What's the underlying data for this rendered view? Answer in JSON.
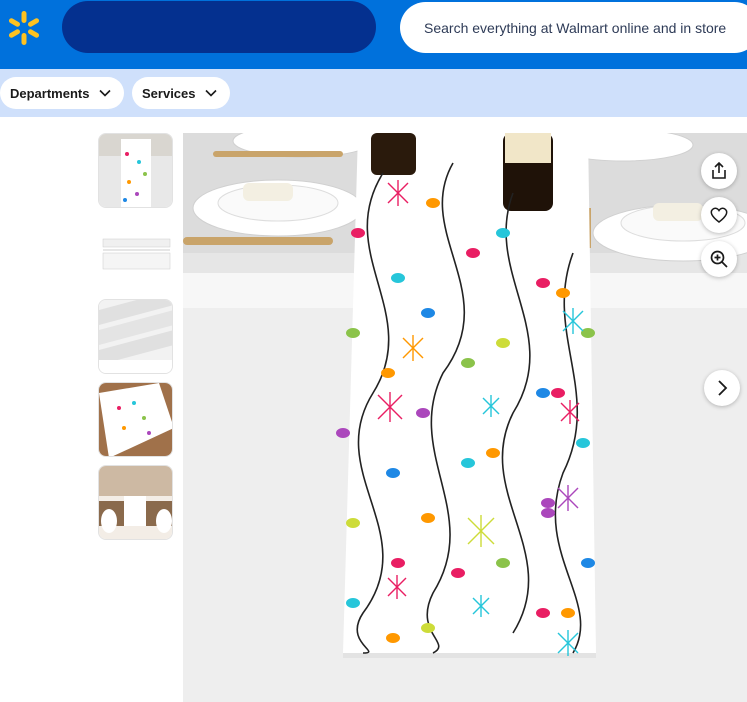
{
  "header": {
    "logo_icon": "walmart-spark-icon",
    "brand_color": "#0071dc",
    "search_placeholder": "Search everything at Walmart online and in store"
  },
  "subnav": {
    "departments_label": "Departments",
    "services_label": "Services"
  },
  "gallery": {
    "thumbnails": [
      {
        "name": "thumbnail-runner-table"
      },
      {
        "name": "thumbnail-size-chart"
      },
      {
        "name": "thumbnail-fabric-detail"
      },
      {
        "name": "thumbnail-runner-angled"
      },
      {
        "name": "thumbnail-dining-room"
      }
    ],
    "actions": {
      "share_icon": "share-icon",
      "favorite_icon": "heart-icon",
      "zoom_icon": "zoom-in-icon",
      "next_icon": "chevron-right-icon"
    }
  }
}
